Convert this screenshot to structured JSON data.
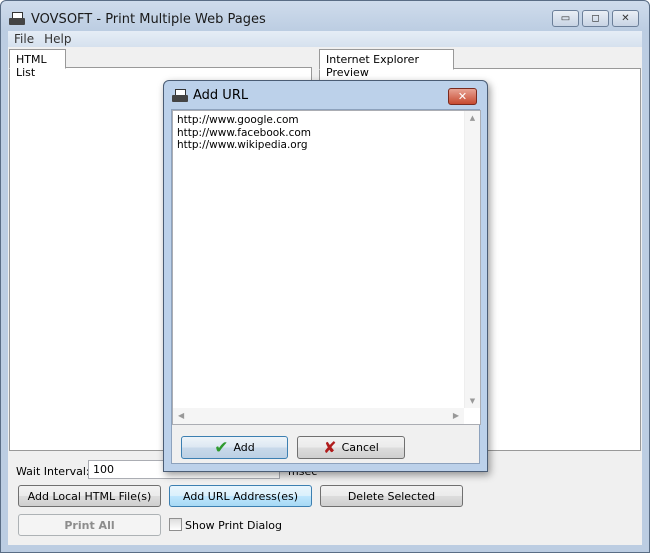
{
  "window": {
    "title": "VOVSOFT - Print Multiple Web Pages",
    "minimize": "▭",
    "maximize": "◻",
    "close": "✕"
  },
  "menu": [
    "File",
    "Help"
  ],
  "tabs": {
    "left": "HTML List",
    "right": "Internet Explorer Preview"
  },
  "wait": {
    "label": "Wait Interval:",
    "value": "100",
    "unit": "msec"
  },
  "buttons": {
    "add_local": "Add Local HTML File(s)",
    "add_url": "Add URL Address(es)",
    "delete": "Delete Selected",
    "print_all": "Print All"
  },
  "show_print_dialog": {
    "label": "Show Print Dialog",
    "checked": false
  },
  "dialog": {
    "title": "Add URL",
    "close": "✕",
    "urls": [
      "http://www.google.com",
      "http://www.facebook.com",
      "http://www.wikipedia.org"
    ],
    "add": "Add",
    "cancel": "Cancel",
    "add_icon": "checkmark-icon",
    "cancel_icon": "x-icon",
    "add_color": "#2e9a2e",
    "cancel_color": "#b01c1c"
  }
}
